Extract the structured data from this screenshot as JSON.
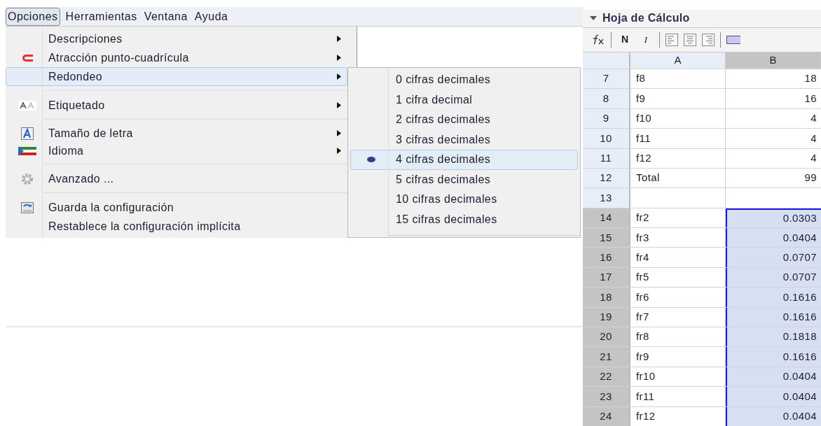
{
  "menubar": [
    {
      "label": "Opciones",
      "selected": true
    },
    {
      "label": "Herramientas",
      "selected": false
    },
    {
      "label": "Ventana",
      "selected": false
    },
    {
      "label": "Ayuda",
      "selected": false
    }
  ],
  "menu": {
    "groups": [
      [
        {
          "label": "Descripciones",
          "submenu": true,
          "selected": false
        },
        {
          "label": "Atracción punto-cuadrícula",
          "submenu": true,
          "selected": false
        },
        {
          "label": "Redondeo",
          "submenu": true,
          "selected": true
        }
      ],
      [
        {
          "label": "Etiquetado",
          "submenu": true,
          "selected": false
        }
      ],
      [
        {
          "label": "Tamaño de letra",
          "submenu": true,
          "selected": false
        },
        {
          "label": "Idioma",
          "submenu": true,
          "selected": false
        }
      ],
      [
        {
          "label": "Avanzado ...",
          "submenu": false,
          "selected": false
        }
      ],
      [
        {
          "label": "Guarda la configuración",
          "submenu": false,
          "selected": false
        },
        {
          "label": "Restablece la configuración implícita",
          "submenu": false,
          "selected": false
        }
      ]
    ]
  },
  "submenu": [
    {
      "label": "0 cifras decimales",
      "selected": false
    },
    {
      "label": "1 cifra decimal",
      "selected": false
    },
    {
      "label": "2 cifras decimales",
      "selected": false
    },
    {
      "label": "3 cifras decimales",
      "selected": false
    },
    {
      "label": "4 cifras decimales",
      "selected": true
    },
    {
      "label": "5 cifras decimales",
      "selected": false
    },
    {
      "label": "10 cifras decimales",
      "selected": false
    },
    {
      "label": "15 cifras decimales",
      "selected": false
    }
  ],
  "spreadsheet": {
    "title": "Hoja de Cálculo",
    "toolbar": {
      "bold": "N",
      "italic": "I"
    },
    "columns": [
      {
        "label": "A",
        "selected": false
      },
      {
        "label": "B",
        "selected": true
      }
    ],
    "rows": [
      {
        "row": "7",
        "a": "f8",
        "b": "18",
        "selected": false
      },
      {
        "row": "8",
        "a": "f9",
        "b": "16",
        "selected": false
      },
      {
        "row": "9",
        "a": "f10",
        "b": "4",
        "selected": false
      },
      {
        "row": "10",
        "a": "f11",
        "b": "4",
        "selected": false
      },
      {
        "row": "11",
        "a": "f12",
        "b": "4",
        "selected": false
      },
      {
        "row": "12",
        "a": "Total",
        "b": "99",
        "selected": false
      },
      {
        "row": "13",
        "selected": false
      },
      {
        "row": "14",
        "a": "fr2",
        "b": "0.0303",
        "selected": true
      },
      {
        "row": "15",
        "a": "fr3",
        "b": "0.0404",
        "selected": true
      },
      {
        "row": "16",
        "a": "fr4",
        "b": "0.0707",
        "selected": true
      },
      {
        "row": "17",
        "a": "fr5",
        "b": "0.0707",
        "selected": true
      },
      {
        "row": "18",
        "a": "fr6",
        "b": "0.1616",
        "selected": true
      },
      {
        "row": "19",
        "a": "fr7",
        "b": "0.1616",
        "selected": true
      },
      {
        "row": "20",
        "a": "fr8",
        "b": "0.1818",
        "selected": true
      },
      {
        "row": "21",
        "a": "fr9",
        "b": "0.1616",
        "selected": true
      },
      {
        "row": "22",
        "a": "fr10",
        "b": "0.0404",
        "selected": true
      },
      {
        "row": "23",
        "a": "fr11",
        "b": "0.0404",
        "selected": true
      },
      {
        "row": "24",
        "a": "fr12",
        "b": "0.0404",
        "selected": true
      }
    ]
  }
}
